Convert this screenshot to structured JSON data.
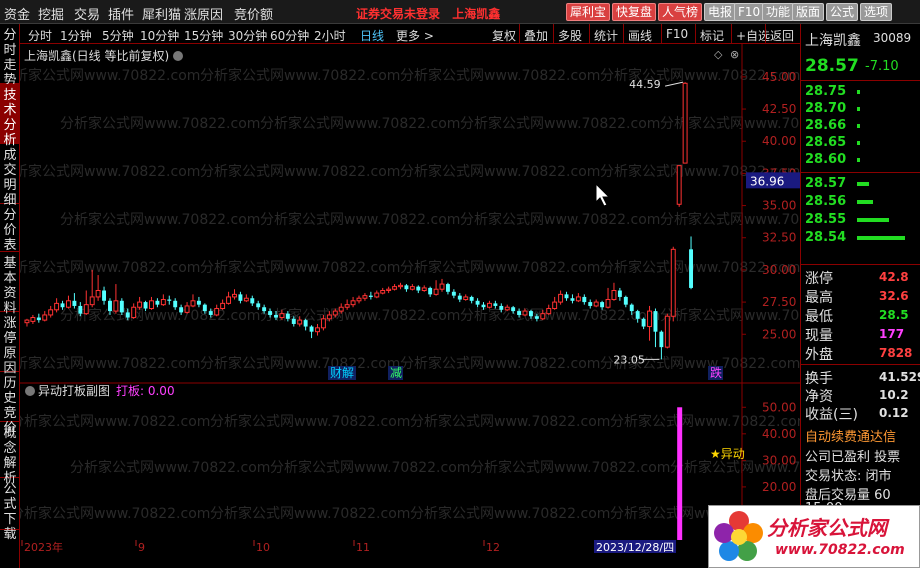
{
  "menu": [
    "资金",
    "挖掘",
    "交易",
    "插件",
    "犀利猫",
    "涨原因",
    "竞价额"
  ],
  "title_notice": "证券交易未登录",
  "title_stock": "上海凯鑫",
  "top_buttons": [
    {
      "label": "犀利宝",
      "style": "red"
    },
    {
      "label": "快复盘",
      "style": "red"
    },
    {
      "label": "人气榜",
      "style": "red"
    },
    {
      "label": "电报",
      "style": "gray"
    },
    {
      "label": "F10",
      "style": "gray"
    },
    {
      "label": "功能",
      "style": "gray"
    },
    {
      "label": "版面",
      "style": "gray"
    },
    {
      "label": "公式",
      "style": "gray"
    },
    {
      "label": "选项",
      "style": "gray"
    }
  ],
  "sidebar": [
    "分时走势",
    "技术分析",
    "成交明细",
    "分价表",
    "基本资料",
    "涨停原因",
    "历史竞价",
    "概念解析",
    "公式下载"
  ],
  "sidebar_active": 1,
  "periods": [
    "分时",
    "1分钟",
    "5分钟",
    "10分钟",
    "15分钟",
    "30分钟",
    "60分钟",
    "2小时",
    "日线",
    "更多 >"
  ],
  "period_selected": 8,
  "tools": [
    "复权",
    "叠加",
    "多股",
    "统计",
    "画线",
    "F10",
    "标记",
    "+自选",
    "返回"
  ],
  "chart_header": "上海凯鑫(日线 等比前复权)",
  "watermark": "分析家公式网www.70822.com",
  "price_axis": [
    "45.00",
    "42.50",
    "40.00",
    "37.50",
    "35.00",
    "32.50",
    "30.00",
    "27.50",
    "25.00"
  ],
  "current_price_tag": "36.96",
  "high_label": "44.59",
  "low_label": "23.05",
  "events": [
    "财解",
    "减",
    "跌"
  ],
  "sub_header": "异动打板副图",
  "sub_indicator": "打板: 0.00",
  "sub_axis": [
    "50.00",
    "40.00",
    "30.00",
    "20.00",
    "10.00"
  ],
  "sub_marker": "★异动",
  "date_axis": [
    "2023年",
    "9",
    "10",
    "11",
    "12"
  ],
  "date_cursor": "2023/12/28/四",
  "right": {
    "name": "上海凯鑫",
    "code": "30089",
    "price": "28.57",
    "change": "-7.10",
    "ask_prices": [
      "28.75",
      "28.70",
      "28.66",
      "28.65",
      "28.60"
    ],
    "bid_prices": [
      "28.57",
      "28.56",
      "28.55",
      "28.54"
    ],
    "stats": [
      {
        "k": "涨停",
        "v": "42.8",
        "c": "#ff4040"
      },
      {
        "k": "最高",
        "v": "32.6",
        "c": "#ff4040"
      },
      {
        "k": "最低",
        "v": "28.5",
        "c": "#22dd22"
      },
      {
        "k": "现量",
        "v": "177",
        "c": "#ff40ff"
      },
      {
        "k": "外盘",
        "v": "7828",
        "c": "#ff4040"
      }
    ],
    "stats2": [
      {
        "k": "换手",
        "v": "41.529"
      },
      {
        "k": "净资",
        "v": "10.2"
      },
      {
        "k": "收益(三)",
        "v": "0.12"
      }
    ],
    "notice": "自动续费通达信",
    "lines": [
      "公司已盈利 投票",
      "交易状态: 闭市",
      "盘后交易量 60"
    ],
    "time": "15:00"
  },
  "logo": {
    "line1": "分析家公式网",
    "line2": "www.70822.com"
  },
  "chart_data": {
    "type": "candlestick",
    "title": "上海凯鑫(日线 等比前复权)",
    "ylim": [
      23,
      46
    ],
    "highest": 44.59,
    "lowest": 23.05,
    "last": 36.96,
    "x_labels": [
      "2023年",
      "9",
      "10",
      "11",
      "12"
    ],
    "candles": [
      [
        25.9,
        26.1,
        25.6,
        26.2
      ],
      [
        26.0,
        26.3,
        25.8,
        26.5
      ],
      [
        26.3,
        26.1,
        25.9,
        26.6
      ],
      [
        26.1,
        26.5,
        26.0,
        26.8
      ],
      [
        26.5,
        26.9,
        26.3,
        27.2
      ],
      [
        26.9,
        27.4,
        26.7,
        27.8
      ],
      [
        27.4,
        27.1,
        26.9,
        27.6
      ],
      [
        27.1,
        27.6,
        27.0,
        28.0
      ],
      [
        27.6,
        27.2,
        27.0,
        28.2
      ],
      [
        27.2,
        26.6,
        26.4,
        27.5
      ],
      [
        26.6,
        27.3,
        26.5,
        28.4
      ],
      [
        27.3,
        27.9,
        27.1,
        30.0
      ],
      [
        27.9,
        28.4,
        27.6,
        29.6
      ],
      [
        28.4,
        27.6,
        27.3,
        28.7
      ],
      [
        27.6,
        26.8,
        26.5,
        27.8
      ],
      [
        26.8,
        27.6,
        26.6,
        28.9
      ],
      [
        27.6,
        26.7,
        26.5,
        27.8
      ],
      [
        26.7,
        26.3,
        26.1,
        27.0
      ],
      [
        26.3,
        27.1,
        26.2,
        27.4
      ],
      [
        27.1,
        27.5,
        26.9,
        27.9
      ],
      [
        27.5,
        27.0,
        26.8,
        27.6
      ],
      [
        27.0,
        27.6,
        26.9,
        27.9
      ],
      [
        27.6,
        27.3,
        27.1,
        27.8
      ],
      [
        27.3,
        27.7,
        27.2,
        28.1
      ],
      [
        27.7,
        27.6,
        27.3,
        28.0
      ],
      [
        27.6,
        27.1,
        26.9,
        27.8
      ],
      [
        27.1,
        26.7,
        26.5,
        27.3
      ],
      [
        26.7,
        27.2,
        26.6,
        27.5
      ],
      [
        27.2,
        27.6,
        27.1,
        28.1
      ],
      [
        27.6,
        27.3,
        27.1,
        27.9
      ],
      [
        27.3,
        26.8,
        26.6,
        27.4
      ],
      [
        26.8,
        26.5,
        26.3,
        27.0
      ],
      [
        26.5,
        27.0,
        26.4,
        27.3
      ],
      [
        27.0,
        27.4,
        26.9,
        27.7
      ],
      [
        27.4,
        27.9,
        27.3,
        28.3
      ],
      [
        27.9,
        28.1,
        27.7,
        28.5
      ],
      [
        28.1,
        27.6,
        27.4,
        28.3
      ],
      [
        27.6,
        27.8,
        27.5,
        28.1
      ],
      [
        27.8,
        27.4,
        27.2,
        28.0
      ],
      [
        27.4,
        27.1,
        26.9,
        27.6
      ],
      [
        27.1,
        26.8,
        26.6,
        27.3
      ],
      [
        26.8,
        26.5,
        26.3,
        27.0
      ],
      [
        26.5,
        26.3,
        26.1,
        26.8
      ],
      [
        26.3,
        26.6,
        26.1,
        26.9
      ],
      [
        26.6,
        26.2,
        26.0,
        26.8
      ],
      [
        26.2,
        25.8,
        25.6,
        26.4
      ],
      [
        25.8,
        26.1,
        25.6,
        26.4
      ],
      [
        26.1,
        25.6,
        25.3,
        26.2
      ],
      [
        25.6,
        25.2,
        24.7,
        25.7
      ],
      [
        25.2,
        25.5,
        24.9,
        25.8
      ],
      [
        25.5,
        26.2,
        25.3,
        26.5
      ],
      [
        26.2,
        26.5,
        26.0,
        26.8
      ],
      [
        26.5,
        26.8,
        26.3,
        27.0
      ],
      [
        26.8,
        27.1,
        26.6,
        27.4
      ],
      [
        27.1,
        27.3,
        26.9,
        27.7
      ],
      [
        27.3,
        27.6,
        27.1,
        27.9
      ],
      [
        27.6,
        27.8,
        27.4,
        28.0
      ],
      [
        27.8,
        28.0,
        27.6,
        28.2
      ],
      [
        28.0,
        27.9,
        27.7,
        28.3
      ],
      [
        27.9,
        28.2,
        27.8,
        28.4
      ],
      [
        28.2,
        28.4,
        28.1,
        28.6
      ],
      [
        28.4,
        28.5,
        28.2,
        28.7
      ],
      [
        28.5,
        28.7,
        28.4,
        28.9
      ],
      [
        28.7,
        28.8,
        28.5,
        29.0
      ],
      [
        28.8,
        28.5,
        28.3,
        28.9
      ],
      [
        28.5,
        28.7,
        28.4,
        28.9
      ],
      [
        28.7,
        28.4,
        28.2,
        28.8
      ],
      [
        28.4,
        28.6,
        28.3,
        28.8
      ],
      [
        28.6,
        28.1,
        27.9,
        28.7
      ],
      [
        28.1,
        28.5,
        28.0,
        29.2
      ],
      [
        28.5,
        28.9,
        28.3,
        29.3
      ],
      [
        28.9,
        28.3,
        28.1,
        29.0
      ],
      [
        28.3,
        28.0,
        27.8,
        28.5
      ],
      [
        28.0,
        27.7,
        27.5,
        28.2
      ],
      [
        27.7,
        27.9,
        27.6,
        28.1
      ],
      [
        27.9,
        27.6,
        27.4,
        28.0
      ],
      [
        27.6,
        27.3,
        27.1,
        27.8
      ],
      [
        27.3,
        27.1,
        26.9,
        27.5
      ],
      [
        27.1,
        27.4,
        27.0,
        27.6
      ],
      [
        27.4,
        27.2,
        27.0,
        27.6
      ],
      [
        27.2,
        26.9,
        26.7,
        27.4
      ],
      [
        26.9,
        27.1,
        26.8,
        27.3
      ],
      [
        27.1,
        26.8,
        26.6,
        27.2
      ],
      [
        26.8,
        26.5,
        26.3,
        27.0
      ],
      [
        26.5,
        26.8,
        26.4,
        27.0
      ],
      [
        26.8,
        26.4,
        26.2,
        26.9
      ],
      [
        26.4,
        26.2,
        26.0,
        26.6
      ],
      [
        26.2,
        26.6,
        26.1,
        26.9
      ],
      [
        26.6,
        27.0,
        26.5,
        27.3
      ],
      [
        27.0,
        27.5,
        26.9,
        27.9
      ],
      [
        27.5,
        28.1,
        27.3,
        28.4
      ],
      [
        28.1,
        27.8,
        27.6,
        28.3
      ],
      [
        27.8,
        27.6,
        27.4,
        28.1
      ],
      [
        27.6,
        27.9,
        27.5,
        28.2
      ],
      [
        27.9,
        27.5,
        27.3,
        28.1
      ],
      [
        27.5,
        27.2,
        27.0,
        27.7
      ],
      [
        27.2,
        27.5,
        27.1,
        27.7
      ],
      [
        27.5,
        27.1,
        26.9,
        27.6
      ],
      [
        27.1,
        27.7,
        27.0,
        28.6
      ],
      [
        27.7,
        28.4,
        27.6,
        29.0
      ],
      [
        28.4,
        27.9,
        27.6,
        28.6
      ],
      [
        27.9,
        27.3,
        27.1,
        28.0
      ],
      [
        27.3,
        26.8,
        26.5,
        27.4
      ],
      [
        26.8,
        26.2,
        25.9,
        26.9
      ],
      [
        26.2,
        25.6,
        25.4,
        26.3
      ],
      [
        25.6,
        26.8,
        24.5,
        27.2
      ],
      [
        26.8,
        25.2,
        24.0,
        27.0
      ],
      [
        25.2,
        24.0,
        23.05,
        25.3
      ],
      [
        24.0,
        26.4,
        23.9,
        26.6
      ],
      [
        26.4,
        31.6,
        26.0,
        31.8
      ],
      [
        35.1,
        38.1,
        34.9,
        38.1
      ],
      [
        38.3,
        44.5,
        38.3,
        44.59
      ],
      [
        31.6,
        28.6,
        28.5,
        32.6
      ]
    ],
    "sub_panel": {
      "name": "异动打板副图",
      "indicator": "打板",
      "value": 0.0,
      "ylim": [
        0,
        55
      ],
      "bar_value": 50
    }
  }
}
